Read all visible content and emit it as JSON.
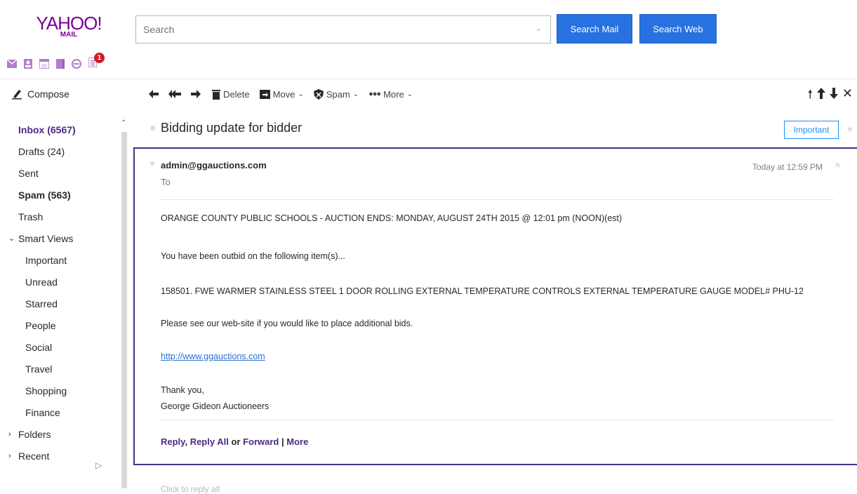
{
  "logo": {
    "line1": "YAHOO!",
    "line2": "MAIL"
  },
  "search": {
    "placeholder": "Search",
    "mail_btn": "Search Mail",
    "web_btn": "Search Web"
  },
  "apps": {
    "badge": "1",
    "icons": [
      "mail-icon",
      "contacts-icon",
      "calendar-icon",
      "notepad-icon",
      "messenger-icon",
      "newsfeed-icon"
    ]
  },
  "toolbar": {
    "compose": "Compose",
    "delete": "Delete",
    "move": "Move",
    "spam": "Spam",
    "more": "More"
  },
  "sidebar": {
    "folders": [
      {
        "label": "Inbox (6567)",
        "style": "purple"
      },
      {
        "label": "Drafts (24)",
        "style": ""
      },
      {
        "label": "Sent",
        "style": ""
      },
      {
        "label": "Spam (563)",
        "style": "bold"
      },
      {
        "label": "Trash",
        "style": ""
      }
    ],
    "smart_views": {
      "label": "Smart Views",
      "items": [
        "Important",
        "Unread",
        "Starred",
        "People",
        "Social",
        "Travel",
        "Shopping",
        "Finance"
      ]
    },
    "folders_section": "Folders",
    "recent_section": "Recent"
  },
  "message": {
    "subject": "Bidding update for bidder",
    "important_btn": "Important",
    "sender": "admin@ggauctions.com",
    "to": "To",
    "date": "Today at 12:59 PM",
    "body": {
      "line1": "ORANGE COUNTY PUBLIC SCHOOLS -  AUCTION ENDS: MONDAY, AUGUST 24TH 2015 @  12:01 pm (NOON)(est)",
      "line2": "You have been outbid on the following item(s)...",
      "line3": "158501.  FWE WARMER  STAINLESS STEEL  1 DOOR  ROLLING  EXTERNAL TEMPERATURE CONTROLS  EXTERNAL TEMPERATURE GAUGE  MODEL# PHU-12",
      "line4": "Please see our web-site if you would like to place additional bids.",
      "link": "http://www.ggauctions.com",
      "closing1": "Thank you,",
      "closing2": "George Gideon Auctioneers"
    },
    "actions": {
      "reply": "Reply",
      "comma": ",",
      "reply_all": "Reply All",
      "or": "or",
      "forward": "Forward",
      "pipe": "|",
      "more": "More"
    },
    "reply_all_prompt": "Click to reply all"
  },
  "colors": {
    "brand": "#7b0099",
    "accent": "#2871e0",
    "selected_border": "#4a2f87",
    "link": "#2d6fd2"
  }
}
